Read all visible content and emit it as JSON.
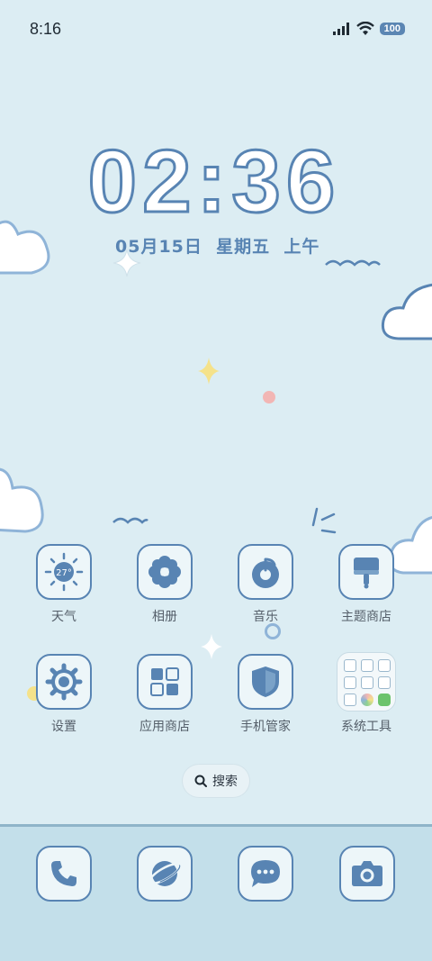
{
  "status_bar": {
    "time": "8:16",
    "battery": "100"
  },
  "lockclock": {
    "time": "02:36",
    "date": "05月15日  星期五  上午"
  },
  "apps": [
    {
      "label": "天气",
      "icon": "weather-icon",
      "temp": "27°"
    },
    {
      "label": "相册",
      "icon": "flower-icon"
    },
    {
      "label": "音乐",
      "icon": "music-icon"
    },
    {
      "label": "主题商店",
      "icon": "paint-brush-icon"
    },
    {
      "label": "设置",
      "icon": "gear-icon"
    },
    {
      "label": "应用商店",
      "icon": "app-grid-icon"
    },
    {
      "label": "手机管家",
      "icon": "shield-icon"
    },
    {
      "label": "系统工具",
      "icon": "folder-icon"
    }
  ],
  "search": {
    "label": "搜索"
  },
  "dock": [
    {
      "icon": "phone-icon"
    },
    {
      "icon": "browser-planet-icon"
    },
    {
      "icon": "message-icon"
    },
    {
      "icon": "camera-icon"
    }
  ],
  "colors": {
    "background": "#dcedf3",
    "accent": "#5884b3",
    "dock": "#c3dfea"
  }
}
